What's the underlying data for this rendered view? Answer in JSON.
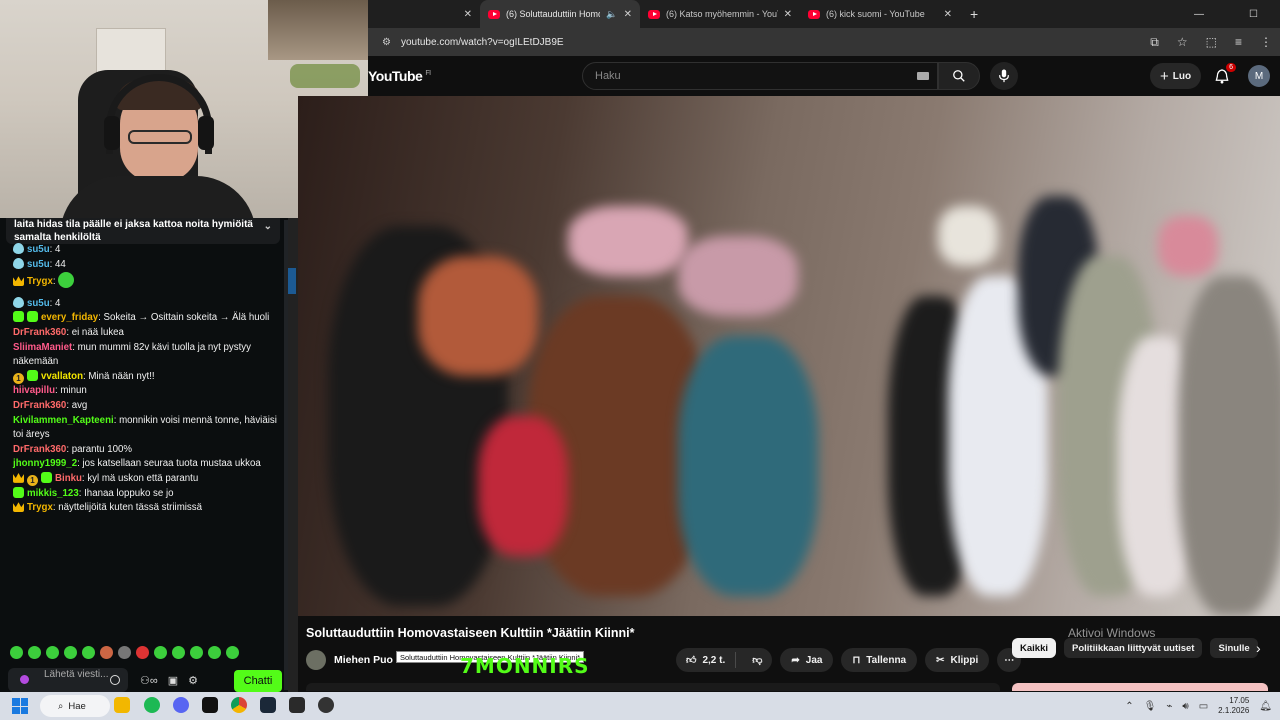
{
  "browser": {
    "tabs": [
      {
        "title": "",
        "active": false
      },
      {
        "title": "(6) Soluttauduttiin Homova",
        "active": true,
        "audio": true
      },
      {
        "title": "(6) Katso myöhemmin - YouTub",
        "active": false
      },
      {
        "title": "(6) kick suomi - YouTube",
        "active": false
      }
    ],
    "new_tab": "+",
    "url": "youtube.com/watch?v=ogILEtDJB9E"
  },
  "youtube": {
    "logo": "YouTube",
    "country": "FI",
    "search_placeholder": "Haku",
    "create_label": "Luo",
    "notification_count": "6",
    "avatar_letter": "M"
  },
  "chat": {
    "pinned_text": "laita hidas tila päälle ei jaksa kattoa noita hymiöitä samalta henkilöltä",
    "messages": [
      {
        "user": "su5u",
        "color": "#53b9e8",
        "badges": [
          "drop"
        ],
        "text": "4"
      },
      {
        "user": "su5u",
        "color": "#53b9e8",
        "badges": [
          "drop"
        ],
        "text": "44"
      },
      {
        "user": "Trygx",
        "color": "#f3b600",
        "badges": [
          "crown"
        ],
        "text": "",
        "emote": true
      },
      {
        "user": "su5u",
        "color": "#53b9e8",
        "badges": [
          "drop"
        ],
        "text": "4"
      },
      {
        "user": "every_friday",
        "color": "#f3b600",
        "badges": [
          "green",
          "green"
        ],
        "text": "Sokeita → Osittain sokeita → Älä huoli"
      },
      {
        "user": "DrFrank360",
        "color": "#ff6a6a",
        "badges": [],
        "text": "ei nää lukea"
      },
      {
        "user": "SliimaManiet",
        "color": "#ff5a8a",
        "badges": [],
        "text": "mun mummi 82v kävi tuolla ja nyt pystyy näkemään"
      },
      {
        "user": "vvallaton",
        "color": "#f3e600",
        "badges": [
          "coin",
          "green"
        ],
        "text": "Minä nään nyt!!"
      },
      {
        "user": "hiivapillu",
        "color": "#ff5a8a",
        "badges": [],
        "text": "minun"
      },
      {
        "user": "DrFrank360",
        "color": "#ff6a6a",
        "badges": [],
        "text": "avg"
      },
      {
        "user": "Kivilammen_Kapteeni",
        "color": "#53fc18",
        "badges": [],
        "text": "monnikin voisi mennä tonne, häviäisi toi äreys"
      },
      {
        "user": "DrFrank360",
        "color": "#ff6a6a",
        "badges": [],
        "text": "parantu 100%"
      },
      {
        "user": "jhonny1999_2",
        "color": "#53fc18",
        "badges": [],
        "text": "jos katsellaan seuraa tuota mustaa ukkoa"
      },
      {
        "user": "Binku",
        "color": "#ff6a6a",
        "badges": [
          "crown",
          "coin",
          "green"
        ],
        "text": "kyl mä uskon että parantu"
      },
      {
        "user": "mikkis_123",
        "color": "#53fc18",
        "badges": [
          "green"
        ],
        "text": "Ihanaa loppuko se jo"
      },
      {
        "user": "Trygx",
        "color": "#f3b600",
        "badges": [
          "crown"
        ],
        "text": "näyttelijöitä kuten tässä striimissä"
      }
    ],
    "input_placeholder": "Lähetä viesti...",
    "send_label": "Chatti"
  },
  "video": {
    "title": "Soluttauduttiin Homovastaiseen Kulttiin *Jäätiin Kiinni*",
    "channel": "Miehen Puo",
    "tooltip": "Soluttauduttiin Homovastaiseen Kulttiin *Jäätiin Kiinni*",
    "watermark": "7MONNIRS",
    "likes": "2,2 t.",
    "share": "Jaa",
    "save": "Tallenna",
    "clip": "Klippi"
  },
  "chips": [
    "Kaikki",
    "Politiikkaan liittyvät uutiset",
    "Sinulle"
  ],
  "windows_watermark": "Aktivoi Windows",
  "taskbar": {
    "search": "Hae",
    "time": "17.05",
    "date": "2.1.2026"
  },
  "colors": {
    "kick_green": "#53fc18",
    "yt_red": "#ff0033"
  }
}
